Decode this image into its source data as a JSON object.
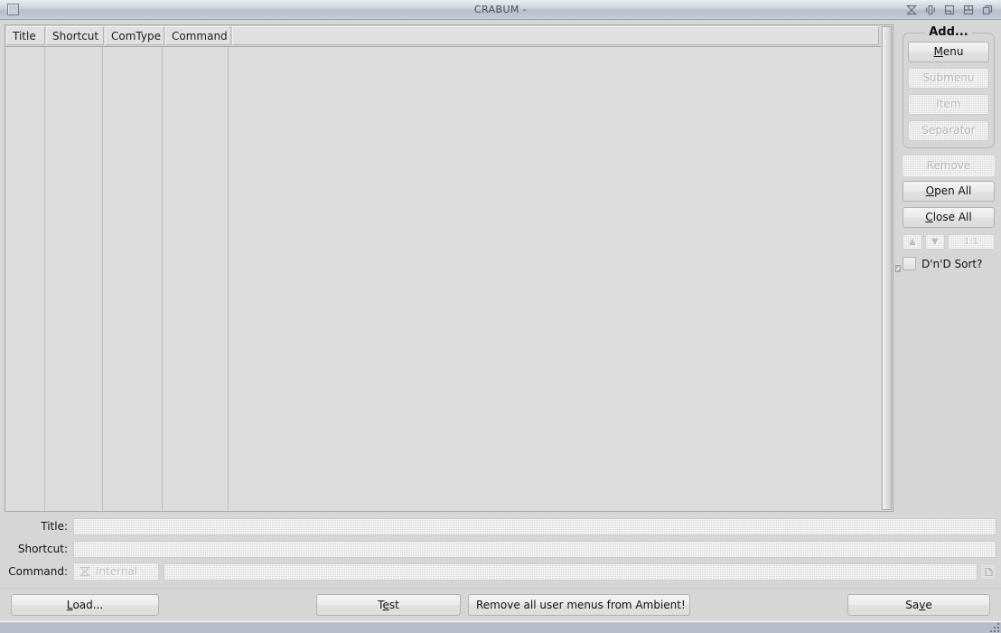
{
  "window": {
    "title": "CRABUM -",
    "menu_button_icon": "window-menu-icon",
    "controls": [
      {
        "name": "shade-button",
        "icon": "shade-icon"
      },
      {
        "name": "iconify-button",
        "icon": "iconify-icon"
      },
      {
        "name": "maximize-button",
        "icon": "maximize-icon"
      },
      {
        "name": "fill-button",
        "icon": "fill-icon"
      },
      {
        "name": "stick-button",
        "icon": "stick-icon"
      }
    ]
  },
  "table": {
    "columns": [
      {
        "label": "Title"
      },
      {
        "label": "Shortcut"
      },
      {
        "label": "ComType"
      },
      {
        "label": "Command"
      },
      {
        "label": ""
      }
    ],
    "rows": []
  },
  "right_panel": {
    "add_group": {
      "title": "Add...",
      "buttons": [
        {
          "label": "Menu",
          "mnemonic": "M",
          "enabled": true
        },
        {
          "label": "Submenu",
          "mnemonic": "S",
          "enabled": false
        },
        {
          "label": "Item",
          "mnemonic": "I",
          "enabled": false
        },
        {
          "label": "Separator",
          "mnemonic": "S",
          "enabled": false
        }
      ]
    },
    "remove_button": {
      "label": "Remove",
      "mnemonic": "R",
      "enabled": false
    },
    "open_all_button": {
      "label": "Open All",
      "mnemonic": "O",
      "enabled": true
    },
    "close_all_button": {
      "label": "Close All",
      "mnemonic": "C",
      "enabled": true
    },
    "mini_buttons": [
      {
        "name": "move-up-button",
        "label": "▲",
        "enabled": false
      },
      {
        "name": "move-down-button",
        "label": "▼",
        "enabled": false
      },
      {
        "name": "one-to-one-button",
        "label": "1:1",
        "enabled": false
      }
    ],
    "dnd_sort": {
      "label": "D'n'D Sort?",
      "mnemonic": "n",
      "checked": false
    }
  },
  "form": {
    "title_row": {
      "label": "Title:",
      "mnemonic": "T",
      "value": "",
      "placeholder": ""
    },
    "shortcut_row": {
      "label": "Shortcut:",
      "mnemonic": "h",
      "value": "",
      "placeholder": ""
    },
    "command_row": {
      "label": "Command:",
      "mnemonic": "C",
      "combo_value": "Internal",
      "combo_icon": "internal-command-icon",
      "value": "",
      "placeholder": "",
      "browse_icon": "file-browse-icon"
    }
  },
  "bottom_bar": {
    "load_button": {
      "label": "Load...",
      "mnemonic": "L"
    },
    "test_button": {
      "label": "Test",
      "mnemonic": "e"
    },
    "remove_all_button": {
      "label": "Remove all user menus from Ambient!",
      "mnemonic": ""
    },
    "save_button": {
      "label": "Save",
      "mnemonic": "v"
    }
  },
  "colors": {
    "window_bg": "#d6d6d6",
    "titlebar_bg": "#c6cad6",
    "desktop": "#9fa3b3",
    "statusbar": "#b9bdcb",
    "disabled_text": "#b6b6b6",
    "text": "#111111"
  }
}
